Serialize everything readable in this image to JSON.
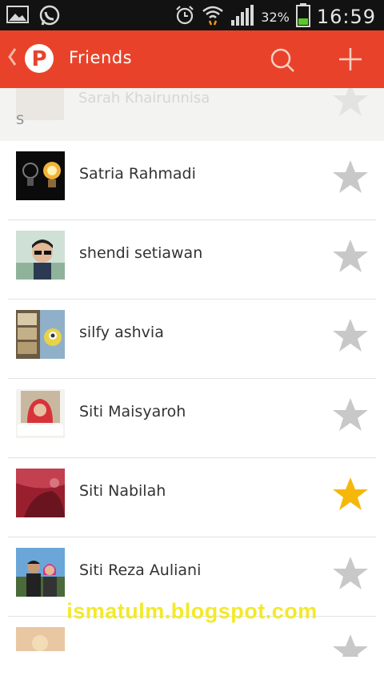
{
  "status_bar": {
    "battery_percent": "32%",
    "time": "16:59",
    "icons": [
      "gallery-icon",
      "whatsapp-icon",
      "alarm-icon",
      "wifi-icon",
      "signal-icon",
      "battery-icon"
    ]
  },
  "action_bar": {
    "title": "Friends",
    "logo_letter": "P",
    "color": "#e8432a",
    "icons": [
      "back-chevron-icon",
      "search-icon",
      "add-icon"
    ]
  },
  "peek_row": {
    "name": "Sarah Khairunnisa",
    "section_letter": "S"
  },
  "friends": [
    {
      "name": "Satria Rahmadi",
      "favorite": false
    },
    {
      "name": "shendi setiawan",
      "favorite": false
    },
    {
      "name": "silfy ashvia",
      "favorite": false
    },
    {
      "name": "Siti Maisyaroh",
      "favorite": false
    },
    {
      "name": "Siti Nabilah",
      "favorite": true
    },
    {
      "name": "Siti Reza Auliani",
      "favorite": false
    }
  ],
  "colors": {
    "star_off": "#c8c8c8",
    "star_on": "#f5b80a"
  },
  "watermark": "ismatulm.blogspot.com"
}
